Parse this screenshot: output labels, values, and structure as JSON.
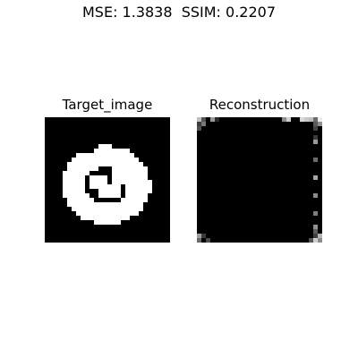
{
  "figure": {
    "suptitle": "MSE: 1.3838  SSIM: 0.2207",
    "panels": [
      {
        "title": "Target_image",
        "grid_size": 28,
        "pixels": [
          "............................",
          "............................",
          "............................",
          "............................",
          "............................",
          "............................",
          "............................",
          "............................",
          "............................",
          "............................",
          "............................",
          "............................",
          "............................",
          "............................",
          "............................",
          "............................",
          "............................",
          "............................",
          "............................",
          "............................",
          "............................",
          "............................",
          "............................",
          "............................",
          "............................",
          "............................",
          "............................",
          "............................"
        ]
      },
      {
        "title": "Reconstruction",
        "grid_size": 28,
        "pixels": []
      }
    ]
  },
  "colors": {
    "panel_bg": "#000000",
    "stroke": "#ffffff",
    "page_bg": "#ffffff"
  }
}
